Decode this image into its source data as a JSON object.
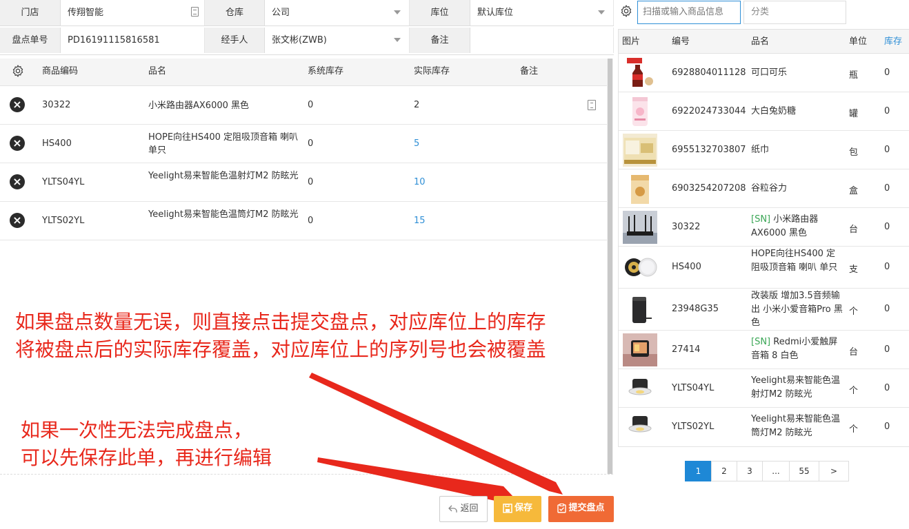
{
  "form": {
    "store_label": "门店",
    "store_value": "传翔智能",
    "warehouse_label": "仓库",
    "warehouse_value": "公司",
    "location_label": "库位",
    "location_value": "默认库位",
    "order_no_label": "盘点单号",
    "order_no_value": "PD16191115816581",
    "handler_label": "经手人",
    "handler_value": "张文彬(ZWB)",
    "remark_label": "备注",
    "remark_value": ""
  },
  "count_table": {
    "headers": {
      "code": "商品编码",
      "name": "品名",
      "system": "系统库存",
      "actual": "实际库存",
      "remark": "备注"
    },
    "rows": [
      {
        "code": "30322",
        "name": "小米路由器AX6000 黑色",
        "system": "0",
        "actual": "2"
      },
      {
        "code": "HS400",
        "name": "HOPE向往HS400 定阻吸顶音箱 喇叭 单只",
        "system": "0",
        "actual": "5"
      },
      {
        "code": "YLTS04YL",
        "name": "Yeelight易来智能色温射灯M2 防眩光",
        "system": "0",
        "actual": "10"
      },
      {
        "code": "YLTS02YL",
        "name": "Yeelight易来智能色温筒灯M2 防眩光",
        "system": "0",
        "actual": "15"
      }
    ]
  },
  "buttons": {
    "back": "返回",
    "save": "保存",
    "submit": "提交盘点"
  },
  "annotations": {
    "line1": "如果盘点数量无误，则直接点击提交盘点，对应库位上的库存",
    "line2": "将被盘点后的实际库存覆盖，对应库位上的序列号也会被覆盖",
    "line3": "如果一次性无法完成盘点，",
    "line4": "可以先保存此单，再进行编辑"
  },
  "product_panel": {
    "search_placeholder": "扫描或输入商品信息",
    "category_placeholder": "分类",
    "headers": {
      "image": "图片",
      "sku": "编号",
      "name": "品名",
      "unit": "单位",
      "stock": "库存"
    },
    "rows": [
      {
        "sku": "6928804011128",
        "sn": "",
        "name": "可口可乐",
        "unit": "瓶",
        "stock": "0"
      },
      {
        "sku": "6922024733044",
        "sn": "",
        "name": "大白兔奶糖",
        "unit": "罐",
        "stock": "0"
      },
      {
        "sku": "6955132703807",
        "sn": "",
        "name": "纸巾",
        "unit": "包",
        "stock": "0"
      },
      {
        "sku": "6903254207208",
        "sn": "",
        "name": "谷粒谷力",
        "unit": "盒",
        "stock": "0"
      },
      {
        "sku": "30322",
        "sn": "[SN]",
        "name": "小米路由器AX6000 黑色",
        "unit": "台",
        "stock": "0"
      },
      {
        "sku": "HS400",
        "sn": "",
        "name": "HOPE向往HS400 定阻吸顶音箱 喇叭 单只",
        "unit": "支",
        "stock": "0"
      },
      {
        "sku": "23948G35",
        "sn": "",
        "name": "改装版 增加3.5音频输出 小米小爱音箱Pro 黑色",
        "unit": "个",
        "stock": "0"
      },
      {
        "sku": "27414",
        "sn": "[SN]",
        "name": "Redmi小爱触屏音箱 8 白色",
        "unit": "台",
        "stock": "0"
      },
      {
        "sku": "YLTS04YL",
        "sn": "",
        "name": "Yeelight易来智能色温射灯M2 防眩光",
        "unit": "个",
        "stock": "0"
      },
      {
        "sku": "YLTS02YL",
        "sn": "",
        "name": "Yeelight易来智能色温筒灯M2 防眩光",
        "unit": "个",
        "stock": "0"
      }
    ],
    "pagination": [
      "1",
      "2",
      "3",
      "...",
      "55",
      ">"
    ],
    "current_page": "1"
  },
  "colors": {
    "accent": "#1e88d6",
    "submit": "#f06a35",
    "save": "#f6b93b",
    "annotation": "#e8281c",
    "sn_tag": "#3aa655"
  }
}
